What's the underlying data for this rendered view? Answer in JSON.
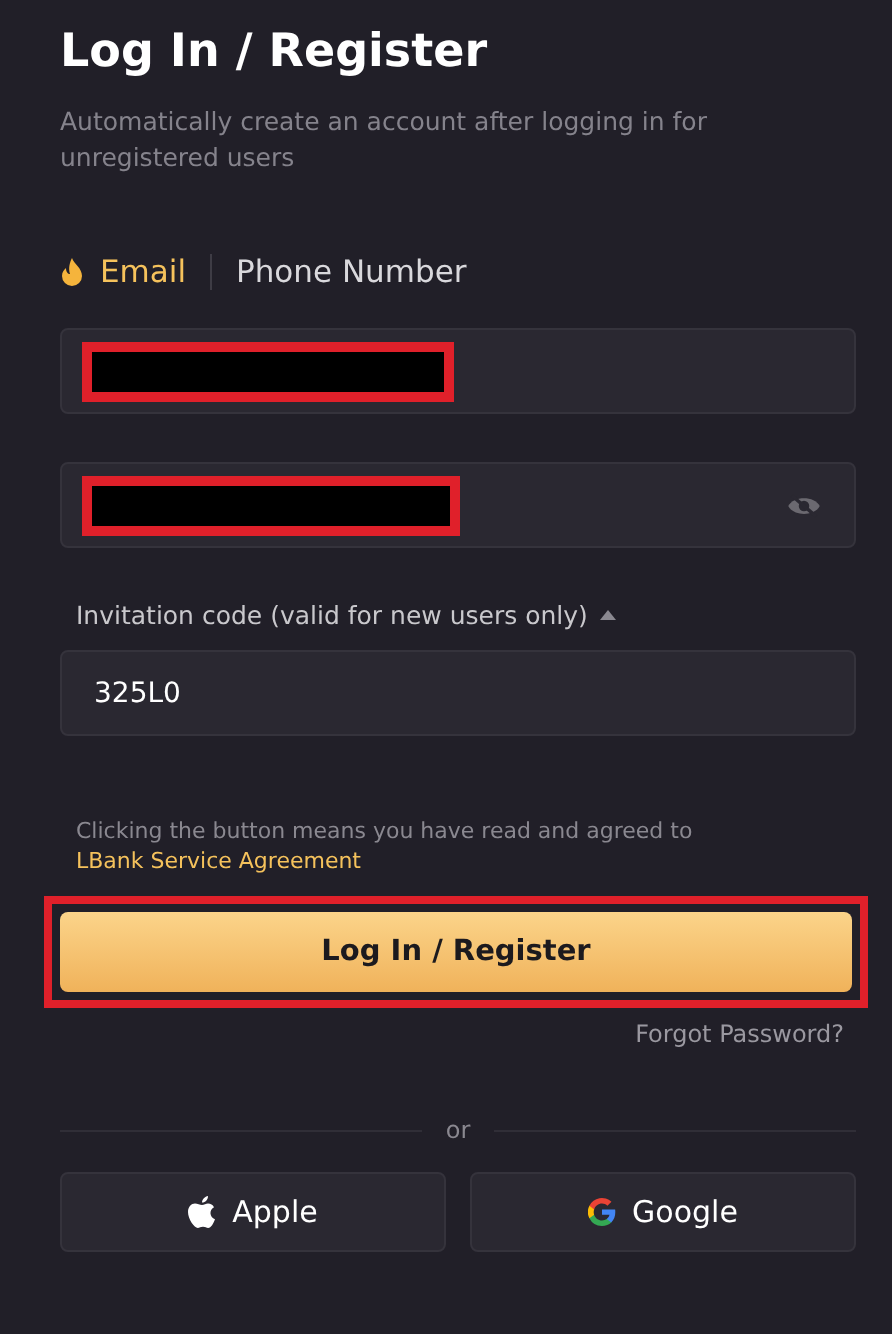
{
  "title": "Log In / Register",
  "subtitle": "Automatically create an account after logging in for unregistered users",
  "tabs": [
    {
      "label": "Email",
      "selected": true,
      "hot": true
    },
    {
      "label": "Phone Number",
      "selected": false,
      "hot": false
    }
  ],
  "invitation": {
    "label": "Invitation code (valid for new users only)",
    "expanded": true,
    "value": "325L0"
  },
  "agreement": {
    "text": "Clicking the button means you have read and agreed to ",
    "link": "LBank Service Agreement"
  },
  "submit": "Log In / Register",
  "forgot": "Forgot Password?",
  "divider": "or",
  "social": [
    {
      "kind": "apple",
      "label": "Apple"
    },
    {
      "kind": "google",
      "label": "Google"
    }
  ]
}
